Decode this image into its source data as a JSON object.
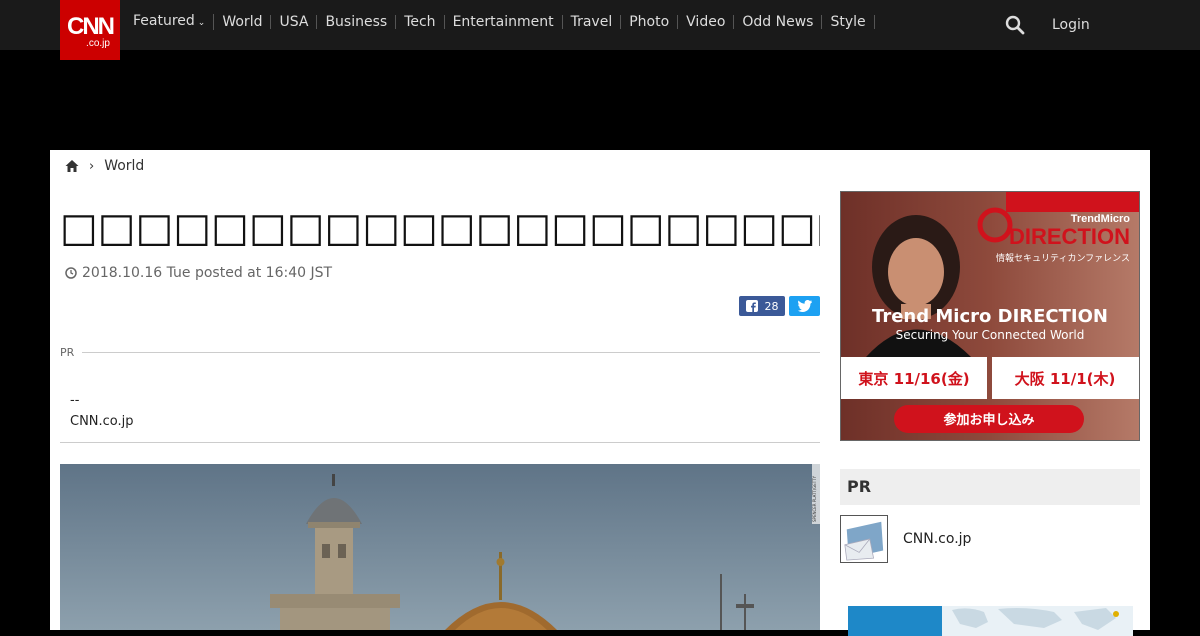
{
  "header": {
    "logo_main": "CNN",
    "logo_sub": ".co.jp",
    "nav": [
      "Featured",
      "World",
      "USA",
      "Business",
      "Tech",
      "Entertainment",
      "Travel",
      "Photo",
      "Video",
      "Odd News",
      "Style"
    ],
    "login": "Login"
  },
  "breadcrumb": {
    "section": "World"
  },
  "article": {
    "title": "□□□□□□□□□□□□□□□□□□□□□□□□□□□□□",
    "dateline": "2018.10.16 Tue posted at 16:40 JST",
    "share_count": "28",
    "pr_label": "PR",
    "pr_line1": "--",
    "pr_line2": "CNN.co.jp",
    "photo_credit": "SPENCER PLATT/GETTY"
  },
  "ad": {
    "brand": "TrendMicro",
    "logo": "DIRECTION",
    "tagline_jp": "情報セキュリティカンファレンス",
    "headline": "Trend Micro DIRECTION",
    "subheadline": "Securing Your Connected World",
    "tokyo": "東京 11/16(金)",
    "osaka": "大阪 11/1(木)",
    "cta": "参加お申し込み"
  },
  "sidebar": {
    "pr_heading": "PR",
    "item_label": "CNN.co.jp"
  },
  "colors": {
    "brand_red": "#cc0000",
    "topbar": "#1a1a1a",
    "facebook": "#3b5998",
    "twitter": "#1da1f2"
  }
}
